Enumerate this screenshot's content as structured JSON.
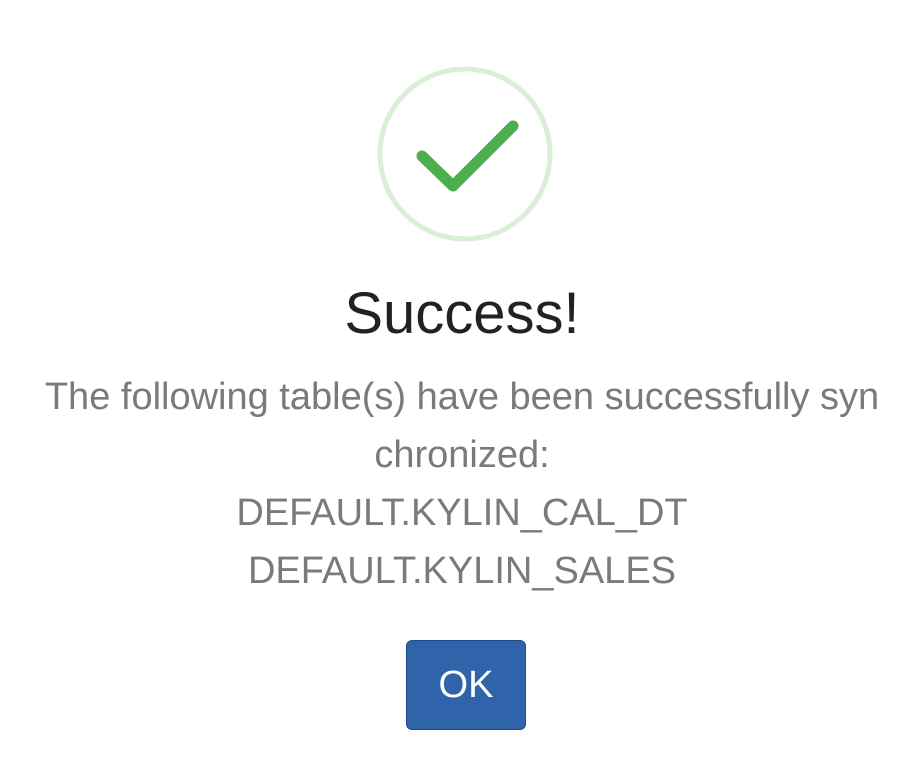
{
  "dialog": {
    "icon": "checkmark-icon",
    "title": "Success!",
    "message_lines": [
      "The following table(s) have been successfully syn",
      "chronized:",
      "DEFAULT.KYLIN_CAL_DT",
      "DEFAULT.KYLIN_SALES"
    ],
    "ok_label": "OK"
  },
  "colors": {
    "success_green": "#4cae4c",
    "ring_green": "#d9efd6",
    "button_blue": "#2f64ab",
    "title_text": "#222222",
    "message_text": "#7a7a7a"
  }
}
